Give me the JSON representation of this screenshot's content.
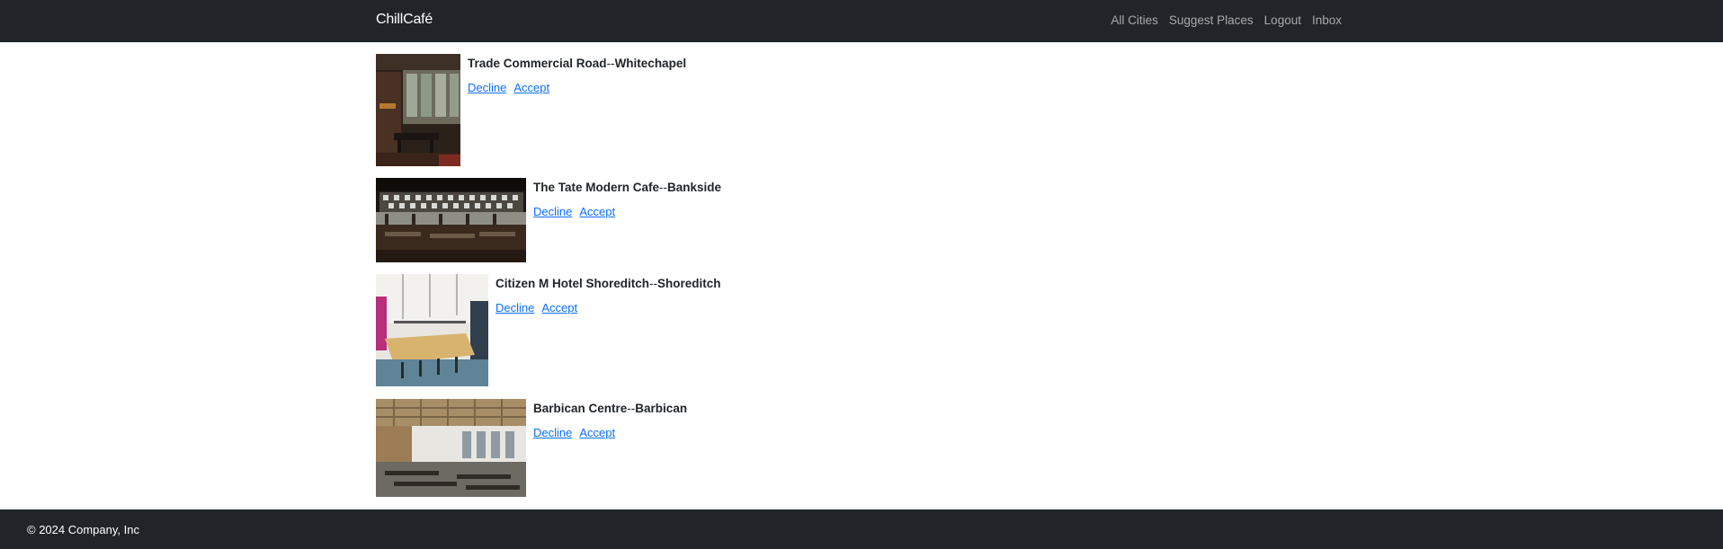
{
  "navbar": {
    "brand": "ChillCafé",
    "links": [
      "All Cities",
      "Suggest Places",
      "Logout",
      "Inbox"
    ]
  },
  "places": [
    {
      "name": "Trade Commercial Road",
      "area": "Whitechapel",
      "separator": "--",
      "decline": "Decline",
      "accept": "Accept"
    },
    {
      "name": "The Tate Modern Cafe",
      "area": "Bankside",
      "separator": "--",
      "decline": "Decline",
      "accept": "Accept"
    },
    {
      "name": "Citizen M Hotel Shoreditch",
      "area": "Shoreditch",
      "separator": "--",
      "decline": "Decline",
      "accept": "Accept"
    },
    {
      "name": "Barbican Centre",
      "area": "Barbican",
      "separator": "--",
      "decline": "Decline",
      "accept": "Accept"
    }
  ],
  "footer": {
    "copyright": "© 2024 Company, Inc"
  }
}
